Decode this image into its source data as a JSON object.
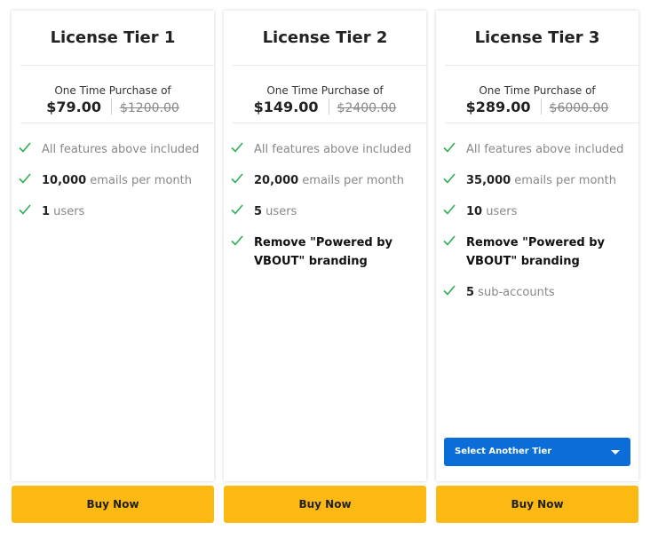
{
  "icons": {
    "feature_check": "check-icon",
    "dropdown_caret": "chevron-down-icon"
  },
  "colors": {
    "check": "#2eae54",
    "buy_button": "#fcb813",
    "select_button": "#0b6ed8"
  },
  "tiers": [
    {
      "title": "License Tier 1",
      "purchase_label": "One Time Purchase of",
      "price": "$79.00",
      "original_price": "$1200.00",
      "features": [
        {
          "strong": "",
          "text": "All features above included"
        },
        {
          "strong": "10,000",
          "text": " emails per month"
        },
        {
          "strong": "1",
          "text": " users"
        }
      ],
      "buy_label": "Buy Now"
    },
    {
      "title": "License Tier 2",
      "purchase_label": "One Time Purchase of",
      "price": "$149.00",
      "original_price": "$2400.00",
      "features": [
        {
          "strong": "",
          "text": "All features above included"
        },
        {
          "strong": "20,000",
          "text": " emails per month"
        },
        {
          "strong": "5",
          "text": " users"
        },
        {
          "strong": "",
          "text": "Remove \"Powered by VBOUT\" branding"
        }
      ],
      "buy_label": "Buy Now"
    },
    {
      "title": "License Tier 3",
      "purchase_label": "One Time Purchase of",
      "price": "$289.00",
      "original_price": "$6000.00",
      "features": [
        {
          "strong": "",
          "text": "All features above included"
        },
        {
          "strong": "35,000",
          "text": " emails per month"
        },
        {
          "strong": "10",
          "text": " users"
        },
        {
          "strong": "",
          "text": "Remove \"Powered by VBOUT\" branding"
        },
        {
          "strong": "5",
          "text": " sub-accounts"
        }
      ],
      "select_label": "Select Another Tier",
      "buy_label": "Buy Now"
    }
  ]
}
